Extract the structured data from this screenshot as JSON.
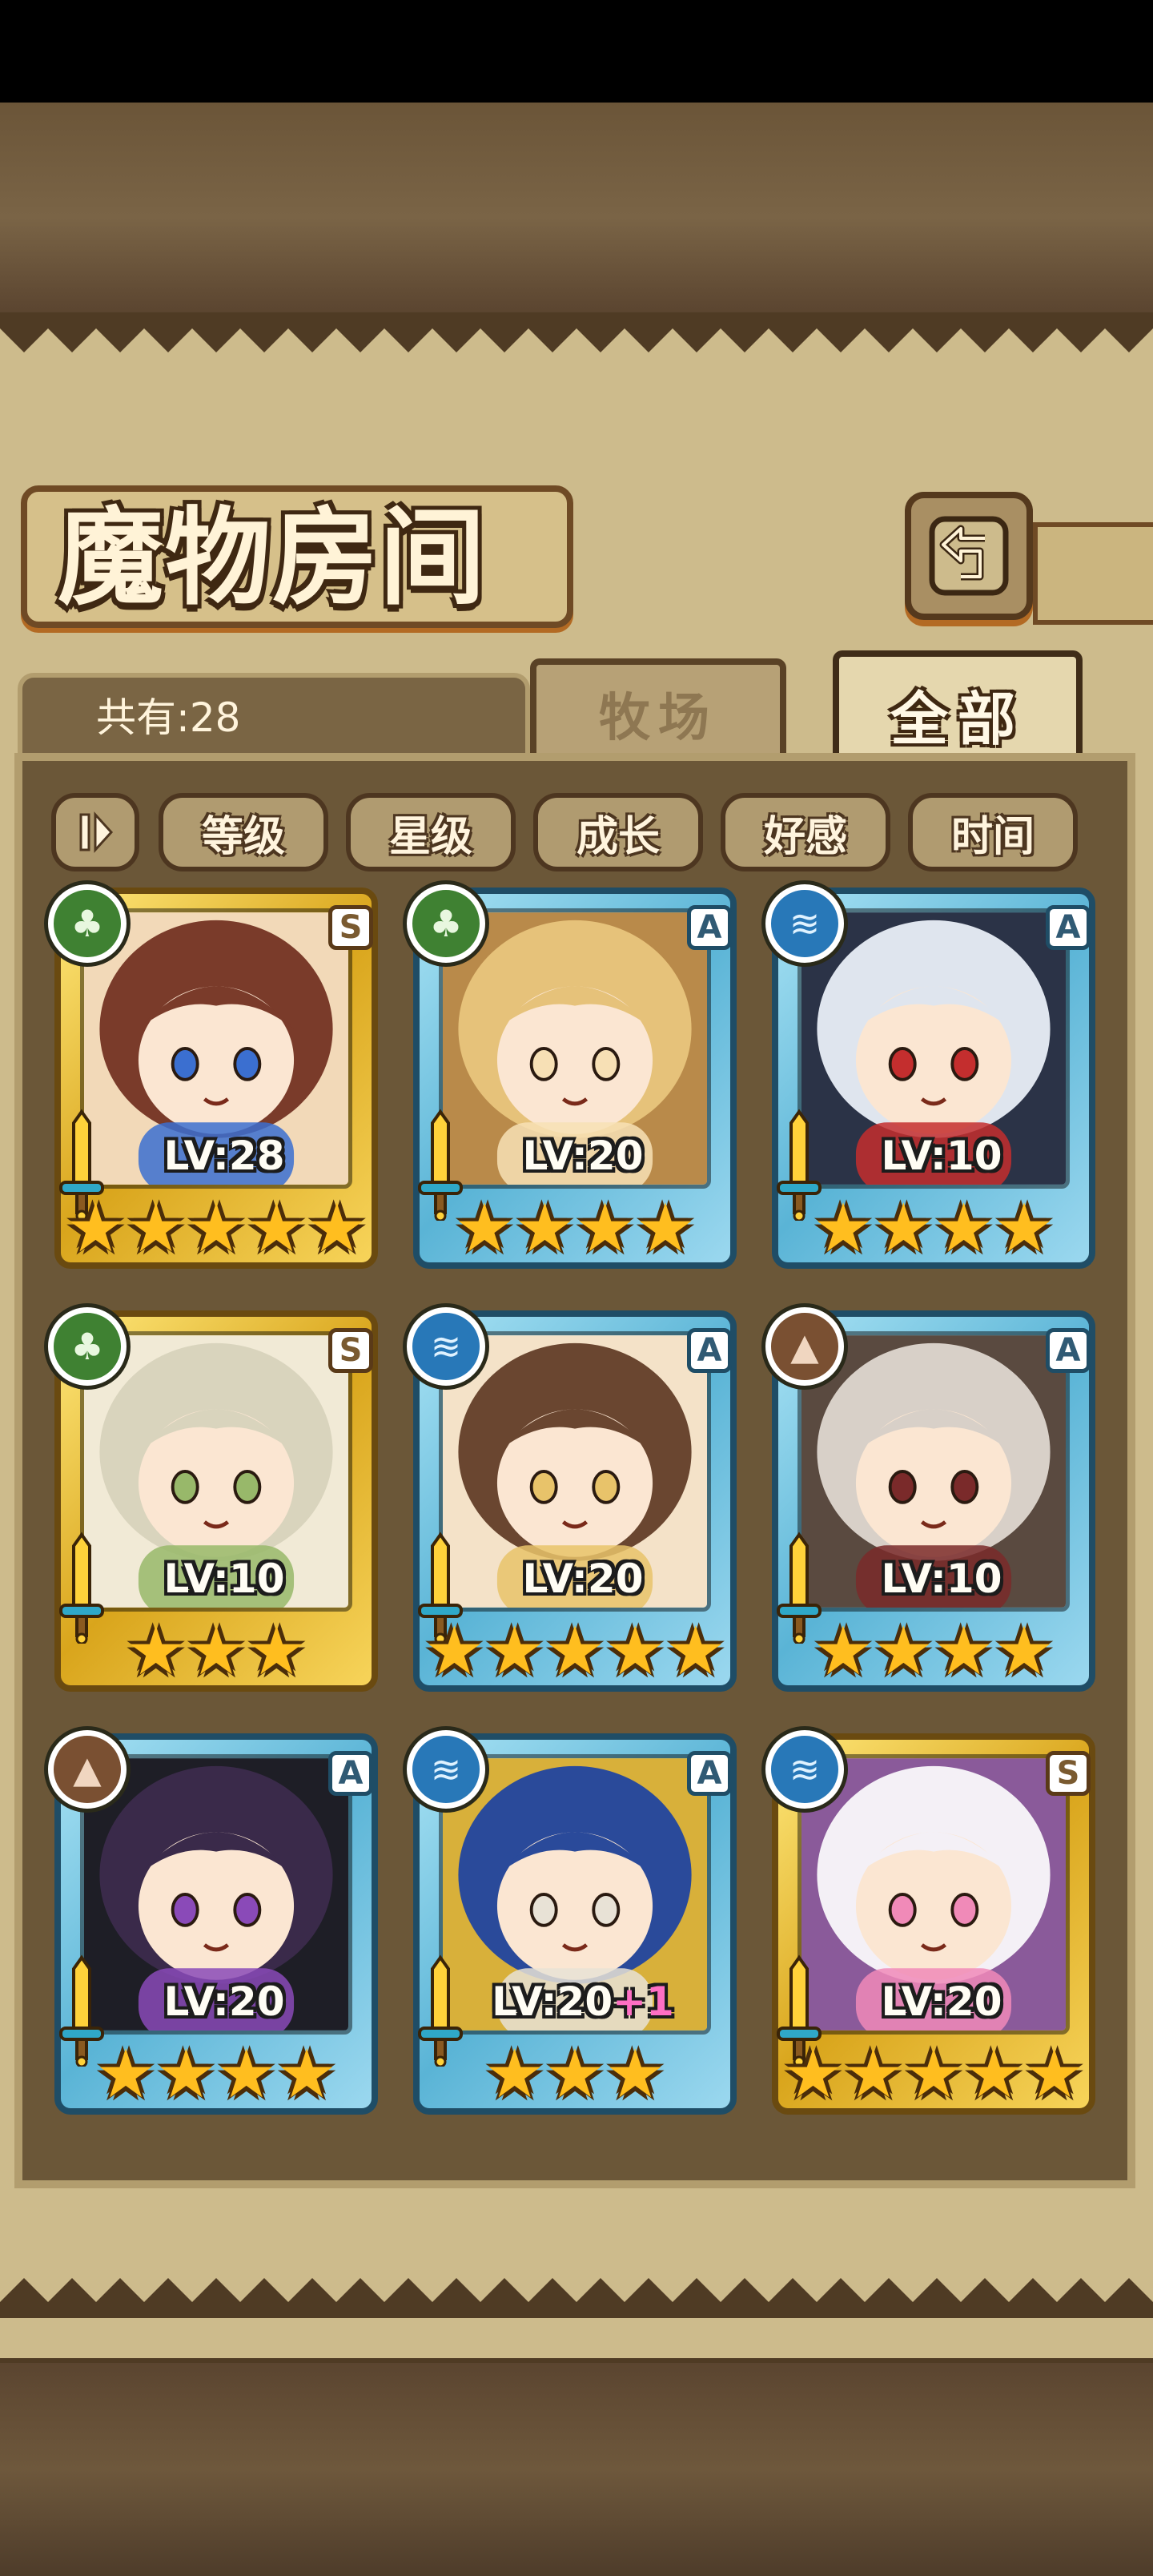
{
  "header": {
    "title": "魔物房间",
    "back_icon": "back-arrow-icon"
  },
  "tabs": {
    "count_label": "共有:28",
    "ranch": "牧场",
    "all": "全部",
    "active": "全部"
  },
  "sort": {
    "order_icon": "sort-order-icon",
    "options": [
      "等级",
      "星级",
      "成长",
      "好感",
      "时间"
    ]
  },
  "colors": {
    "rank_s_frame": "#e8bf3a",
    "rank_a_frame": "#6ec2e2",
    "grass": "#3f8132",
    "water": "#2878b8",
    "earth": "#7a5032",
    "star": "#ffbe1f",
    "bonus": "#ff6fc4"
  },
  "monsters": [
    {
      "grade": "S",
      "element": "grass",
      "level": "LV:28",
      "bonus": "",
      "stars": 5
    },
    {
      "grade": "A",
      "element": "grass",
      "level": "LV:20",
      "bonus": "",
      "stars": 4
    },
    {
      "grade": "A",
      "element": "water",
      "level": "LV:10",
      "bonus": "",
      "stars": 4
    },
    {
      "grade": "S",
      "element": "grass",
      "level": "LV:10",
      "bonus": "",
      "stars": 3
    },
    {
      "grade": "A",
      "element": "water",
      "level": "LV:20",
      "bonus": "",
      "stars": 5
    },
    {
      "grade": "A",
      "element": "earth",
      "level": "LV:10",
      "bonus": "",
      "stars": 4
    },
    {
      "grade": "A",
      "element": "earth",
      "level": "LV:20",
      "bonus": "",
      "stars": 4
    },
    {
      "grade": "A",
      "element": "water",
      "level": "LV:20",
      "bonus": "+1",
      "stars": 3
    },
    {
      "grade": "S",
      "element": "water",
      "level": "LV:20",
      "bonus": "",
      "stars": 5
    }
  ]
}
